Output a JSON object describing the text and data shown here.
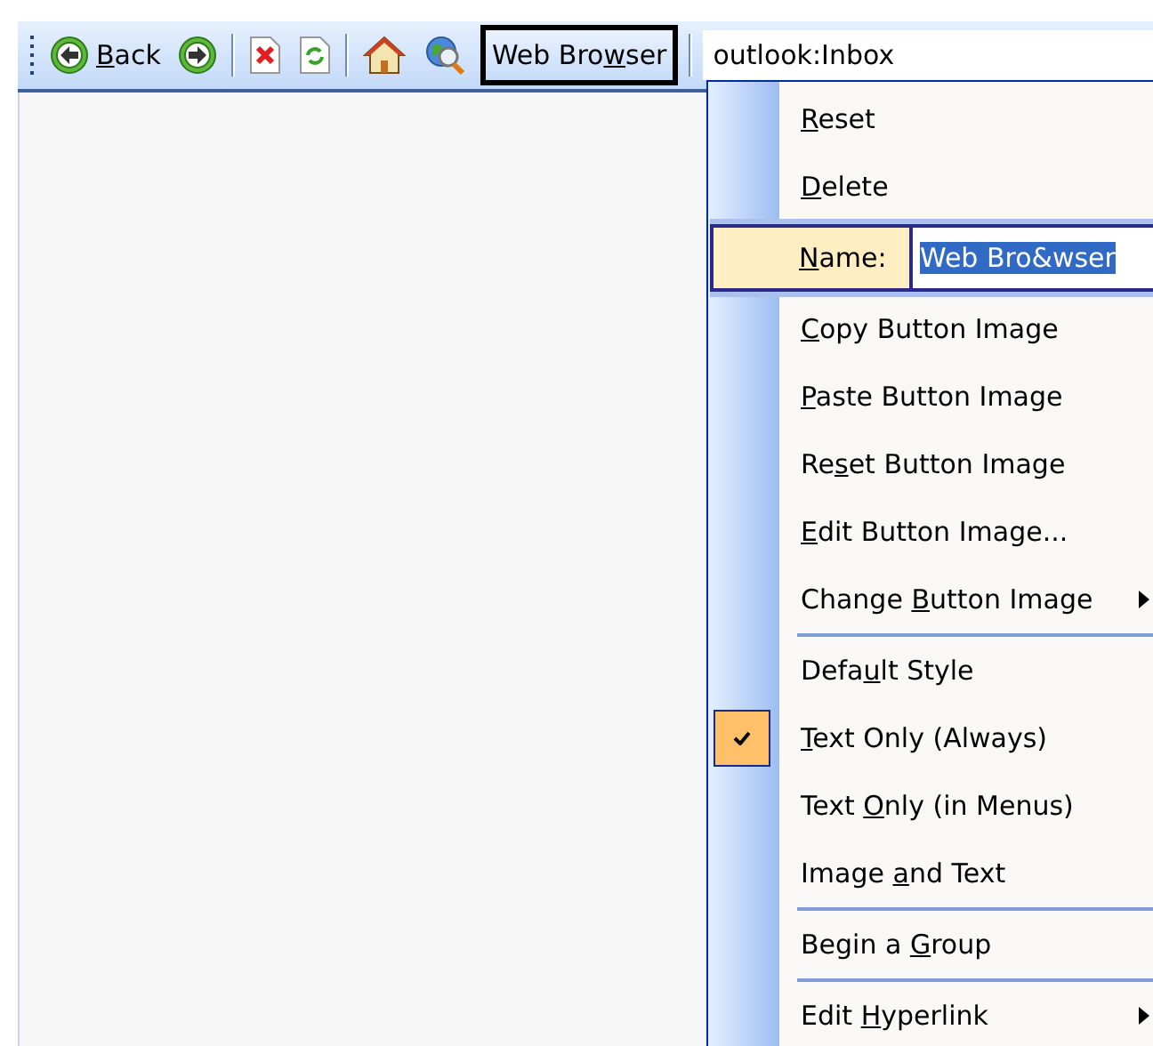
{
  "toolbar": {
    "items": [
      {
        "kind": "back",
        "label": {
          "key": "B",
          "after": "ack"
        }
      },
      {
        "kind": "forward"
      },
      {
        "kind": "separator"
      },
      {
        "kind": "stop"
      },
      {
        "kind": "refresh"
      },
      {
        "kind": "separator"
      },
      {
        "kind": "home"
      },
      {
        "kind": "search"
      },
      {
        "kind": "text_button",
        "label": {
          "before": "Web Bro",
          "key": "w",
          "after": "ser"
        },
        "selected": true
      },
      {
        "kind": "separator"
      },
      {
        "kind": "address",
        "value": "outlook:Inbox"
      }
    ]
  },
  "context_menu": {
    "items": [
      {
        "kind": "command",
        "label": {
          "key": "R",
          "after": "eset"
        },
        "checked": false,
        "submenu": false,
        "begins_group": false
      },
      {
        "kind": "command",
        "label": {
          "key": "D",
          "after": "elete"
        },
        "checked": false,
        "submenu": false,
        "begins_group": false
      },
      {
        "kind": "name_field",
        "label": {
          "key": "N",
          "after": "ame:"
        },
        "value": "Web Bro&wser",
        "text_selected": true
      },
      {
        "kind": "command",
        "label": {
          "key": "C",
          "after": "opy Button Image"
        },
        "checked": false,
        "submenu": false,
        "begins_group": false
      },
      {
        "kind": "command",
        "label": {
          "key": "P",
          "after": "aste Button Image"
        },
        "checked": false,
        "submenu": false,
        "begins_group": false
      },
      {
        "kind": "command",
        "label": {
          "before": "Re",
          "key": "s",
          "after": "et Button Image"
        },
        "checked": false,
        "submenu": false,
        "begins_group": false
      },
      {
        "kind": "command",
        "label": {
          "key": "E",
          "after": "dit Button Image..."
        },
        "checked": false,
        "submenu": false,
        "begins_group": false
      },
      {
        "kind": "command",
        "label": {
          "before": "Change ",
          "key": "B",
          "after": "utton Image"
        },
        "checked": false,
        "submenu": true,
        "begins_group": false
      },
      {
        "kind": "command",
        "label": {
          "before": "Defa",
          "key": "u",
          "after": "lt Style"
        },
        "checked": false,
        "submenu": false,
        "begins_group": true
      },
      {
        "kind": "command",
        "label": {
          "key": "T",
          "after": "ext Only (Always)"
        },
        "checked": true,
        "submenu": false,
        "begins_group": false
      },
      {
        "kind": "command",
        "label": {
          "before": "Text ",
          "key": "O",
          "after": "nly (in Menus)"
        },
        "checked": false,
        "submenu": false,
        "begins_group": false
      },
      {
        "kind": "command",
        "label": {
          "before": "Image ",
          "key": "a",
          "after": "nd Text"
        },
        "checked": false,
        "submenu": false,
        "begins_group": false
      },
      {
        "kind": "command",
        "label": {
          "before": "Begin a ",
          "key": "G",
          "after": "roup"
        },
        "checked": false,
        "submenu": false,
        "begins_group": true
      },
      {
        "kind": "command",
        "label": {
          "before": "Edit ",
          "key": "H",
          "after": "yperlink"
        },
        "checked": false,
        "submenu": true,
        "begins_group": true
      }
    ]
  }
}
